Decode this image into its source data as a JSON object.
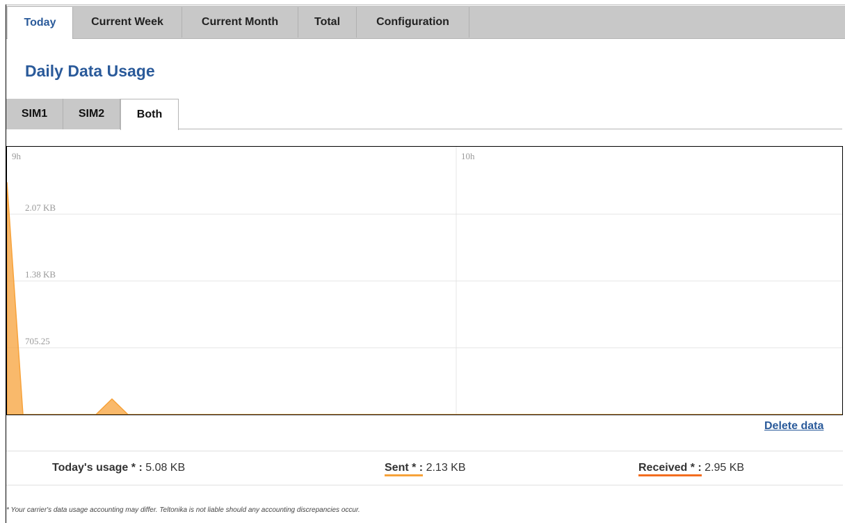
{
  "tabs": [
    {
      "label": "Today",
      "active": true
    },
    {
      "label": "Current Week",
      "active": false
    },
    {
      "label": "Current Month",
      "active": false
    },
    {
      "label": "Total",
      "active": false
    },
    {
      "label": "Configuration",
      "active": false
    }
  ],
  "page_title": "Daily Data Usage",
  "sim_tabs": [
    {
      "label": "SIM1",
      "active": false
    },
    {
      "label": "SIM2",
      "active": false
    },
    {
      "label": "Both",
      "active": true
    }
  ],
  "chart_data": {
    "type": "area",
    "x_labels": [
      "9h",
      "10h"
    ],
    "y_labels": [
      "2.07 KB",
      "1.38 KB",
      "705.25"
    ],
    "series": [
      {
        "values": [
          2.4,
          0,
          0,
          0.16,
          0,
          0
        ],
        "color": "#f7a23a"
      }
    ]
  },
  "delete_link": "Delete data",
  "stats": {
    "today_label": "Today's usage * :",
    "today_value": "5.08 KB",
    "sent_label": "Sent * :",
    "sent_value": "2.13 KB",
    "received_label": "Received * :",
    "received_value": "2.95 KB"
  },
  "footnote": "* Your carrier's data usage accounting may differ. Teltonika is not liable should any accounting discrepancies occur.",
  "colors": {
    "accent": "#2a5a9a",
    "sent": "#f7a23a",
    "received": "#f36d1f"
  }
}
